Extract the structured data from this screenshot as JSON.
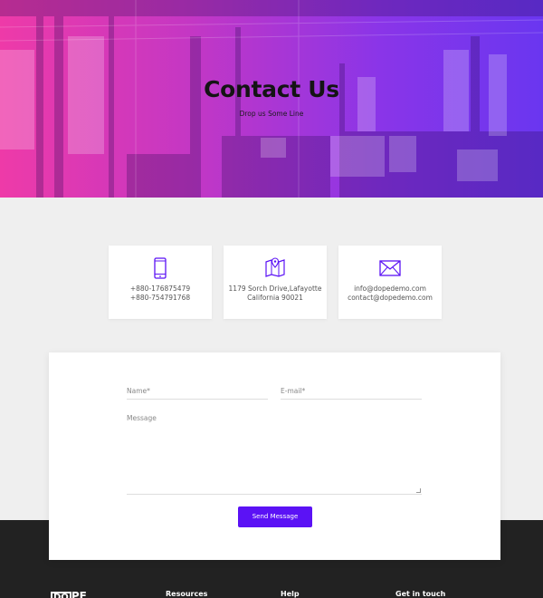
{
  "hero": {
    "title": "Contact Us",
    "subtitle": "Drop us Some Line"
  },
  "cards": [
    {
      "icon": "phone-icon",
      "line1": "+880-176875479",
      "line2": "+880-754791768"
    },
    {
      "icon": "map-pin-icon",
      "line1": "1179 Sorch Drive,Lafayotte",
      "line2": "California 90021"
    },
    {
      "icon": "mail-icon",
      "line1": "info@dopedemo.com",
      "line2": "contact@dopedemo.com"
    }
  ],
  "form": {
    "name_placeholder": "Name*",
    "email_placeholder": "E-mail*",
    "message_placeholder": "Message",
    "send_label": "Send Message"
  },
  "footer": {
    "logo_box": "DO",
    "logo_rest": "PE",
    "col1": "Resources",
    "col2": "Help",
    "col3": "Get in touch"
  },
  "colors": {
    "accent": "#5b12f5",
    "hero_gradient_start": "#ee3aa8",
    "hero_gradient_end": "#6a36f0",
    "footer_bg": "#222222"
  }
}
